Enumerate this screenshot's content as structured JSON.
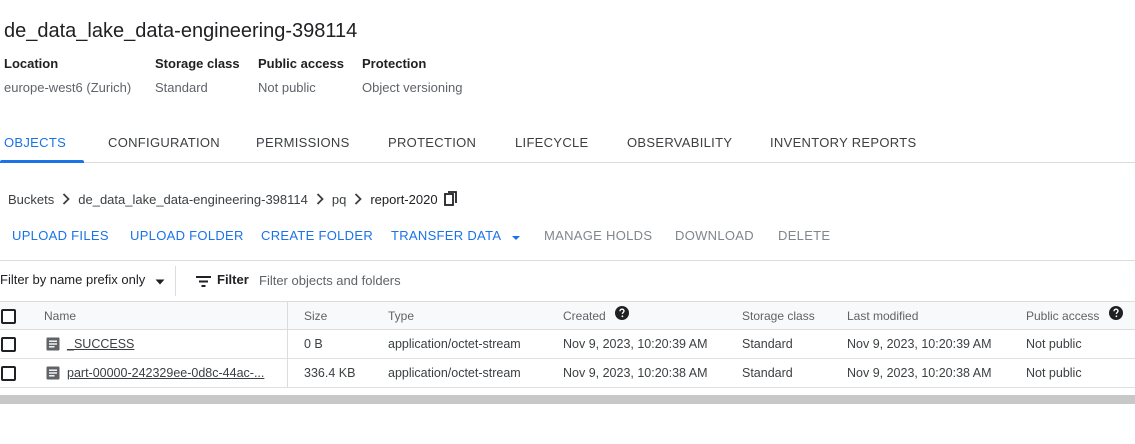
{
  "bucket": {
    "title": "de_data_lake_data-engineering-398114",
    "info": [
      {
        "label": "Location",
        "value": "europe-west6 (Zurich)"
      },
      {
        "label": "Storage class",
        "value": "Standard"
      },
      {
        "label": "Public access",
        "value": "Not public"
      },
      {
        "label": "Protection",
        "value": "Object versioning"
      }
    ]
  },
  "tabs": [
    {
      "label": "OBJECTS",
      "active": true
    },
    {
      "label": "CONFIGURATION"
    },
    {
      "label": "PERMISSIONS"
    },
    {
      "label": "PROTECTION"
    },
    {
      "label": "LIFECYCLE"
    },
    {
      "label": "OBSERVABILITY"
    },
    {
      "label": "INVENTORY REPORTS"
    }
  ],
  "breadcrumb": {
    "items": [
      "Buckets",
      "de_data_lake_data-engineering-398114",
      "pq",
      "report-2020"
    ],
    "copy_icon": "copy-icon"
  },
  "actions": [
    {
      "label": "UPLOAD FILES",
      "enabled": true
    },
    {
      "label": "UPLOAD FOLDER",
      "enabled": true
    },
    {
      "label": "CREATE FOLDER",
      "enabled": true
    },
    {
      "label": "TRANSFER DATA",
      "enabled": true,
      "dropdown": true
    },
    {
      "label": "MANAGE HOLDS",
      "enabled": false
    },
    {
      "label": "DOWNLOAD",
      "enabled": false
    },
    {
      "label": "DELETE",
      "enabled": false
    }
  ],
  "filter": {
    "mode_label": "Filter by name prefix only",
    "filter_label": "Filter",
    "placeholder": "Filter objects and folders",
    "value": ""
  },
  "table": {
    "headers": {
      "name": "Name",
      "size": "Size",
      "type": "Type",
      "created": "Created",
      "storage_class": "Storage class",
      "last_modified": "Last modified",
      "public_access": "Public access"
    },
    "rows": [
      {
        "name": "_SUCCESS",
        "size": "0 B",
        "type": "application/octet-stream",
        "created": "Nov 9, 2023, 10:20:39 AM",
        "storage_class": "Standard",
        "last_modified": "Nov 9, 2023, 10:20:39 AM",
        "public_access": "Not public"
      },
      {
        "name": "part-00000-242329ee-0d8c-44ac-...",
        "size": "336.4 KB",
        "type": "application/octet-stream",
        "created": "Nov 9, 2023, 10:20:38 AM",
        "storage_class": "Standard",
        "last_modified": "Nov 9, 2023, 10:20:38 AM",
        "public_access": "Not public"
      }
    ]
  },
  "colors": {
    "accent": "#1a73e8",
    "text": "#202124",
    "muted": "#5f6368",
    "disabled": "#80868b",
    "link": "#1a4dab",
    "header_bg": "#f8f9fa",
    "divider": "#dadce0"
  }
}
